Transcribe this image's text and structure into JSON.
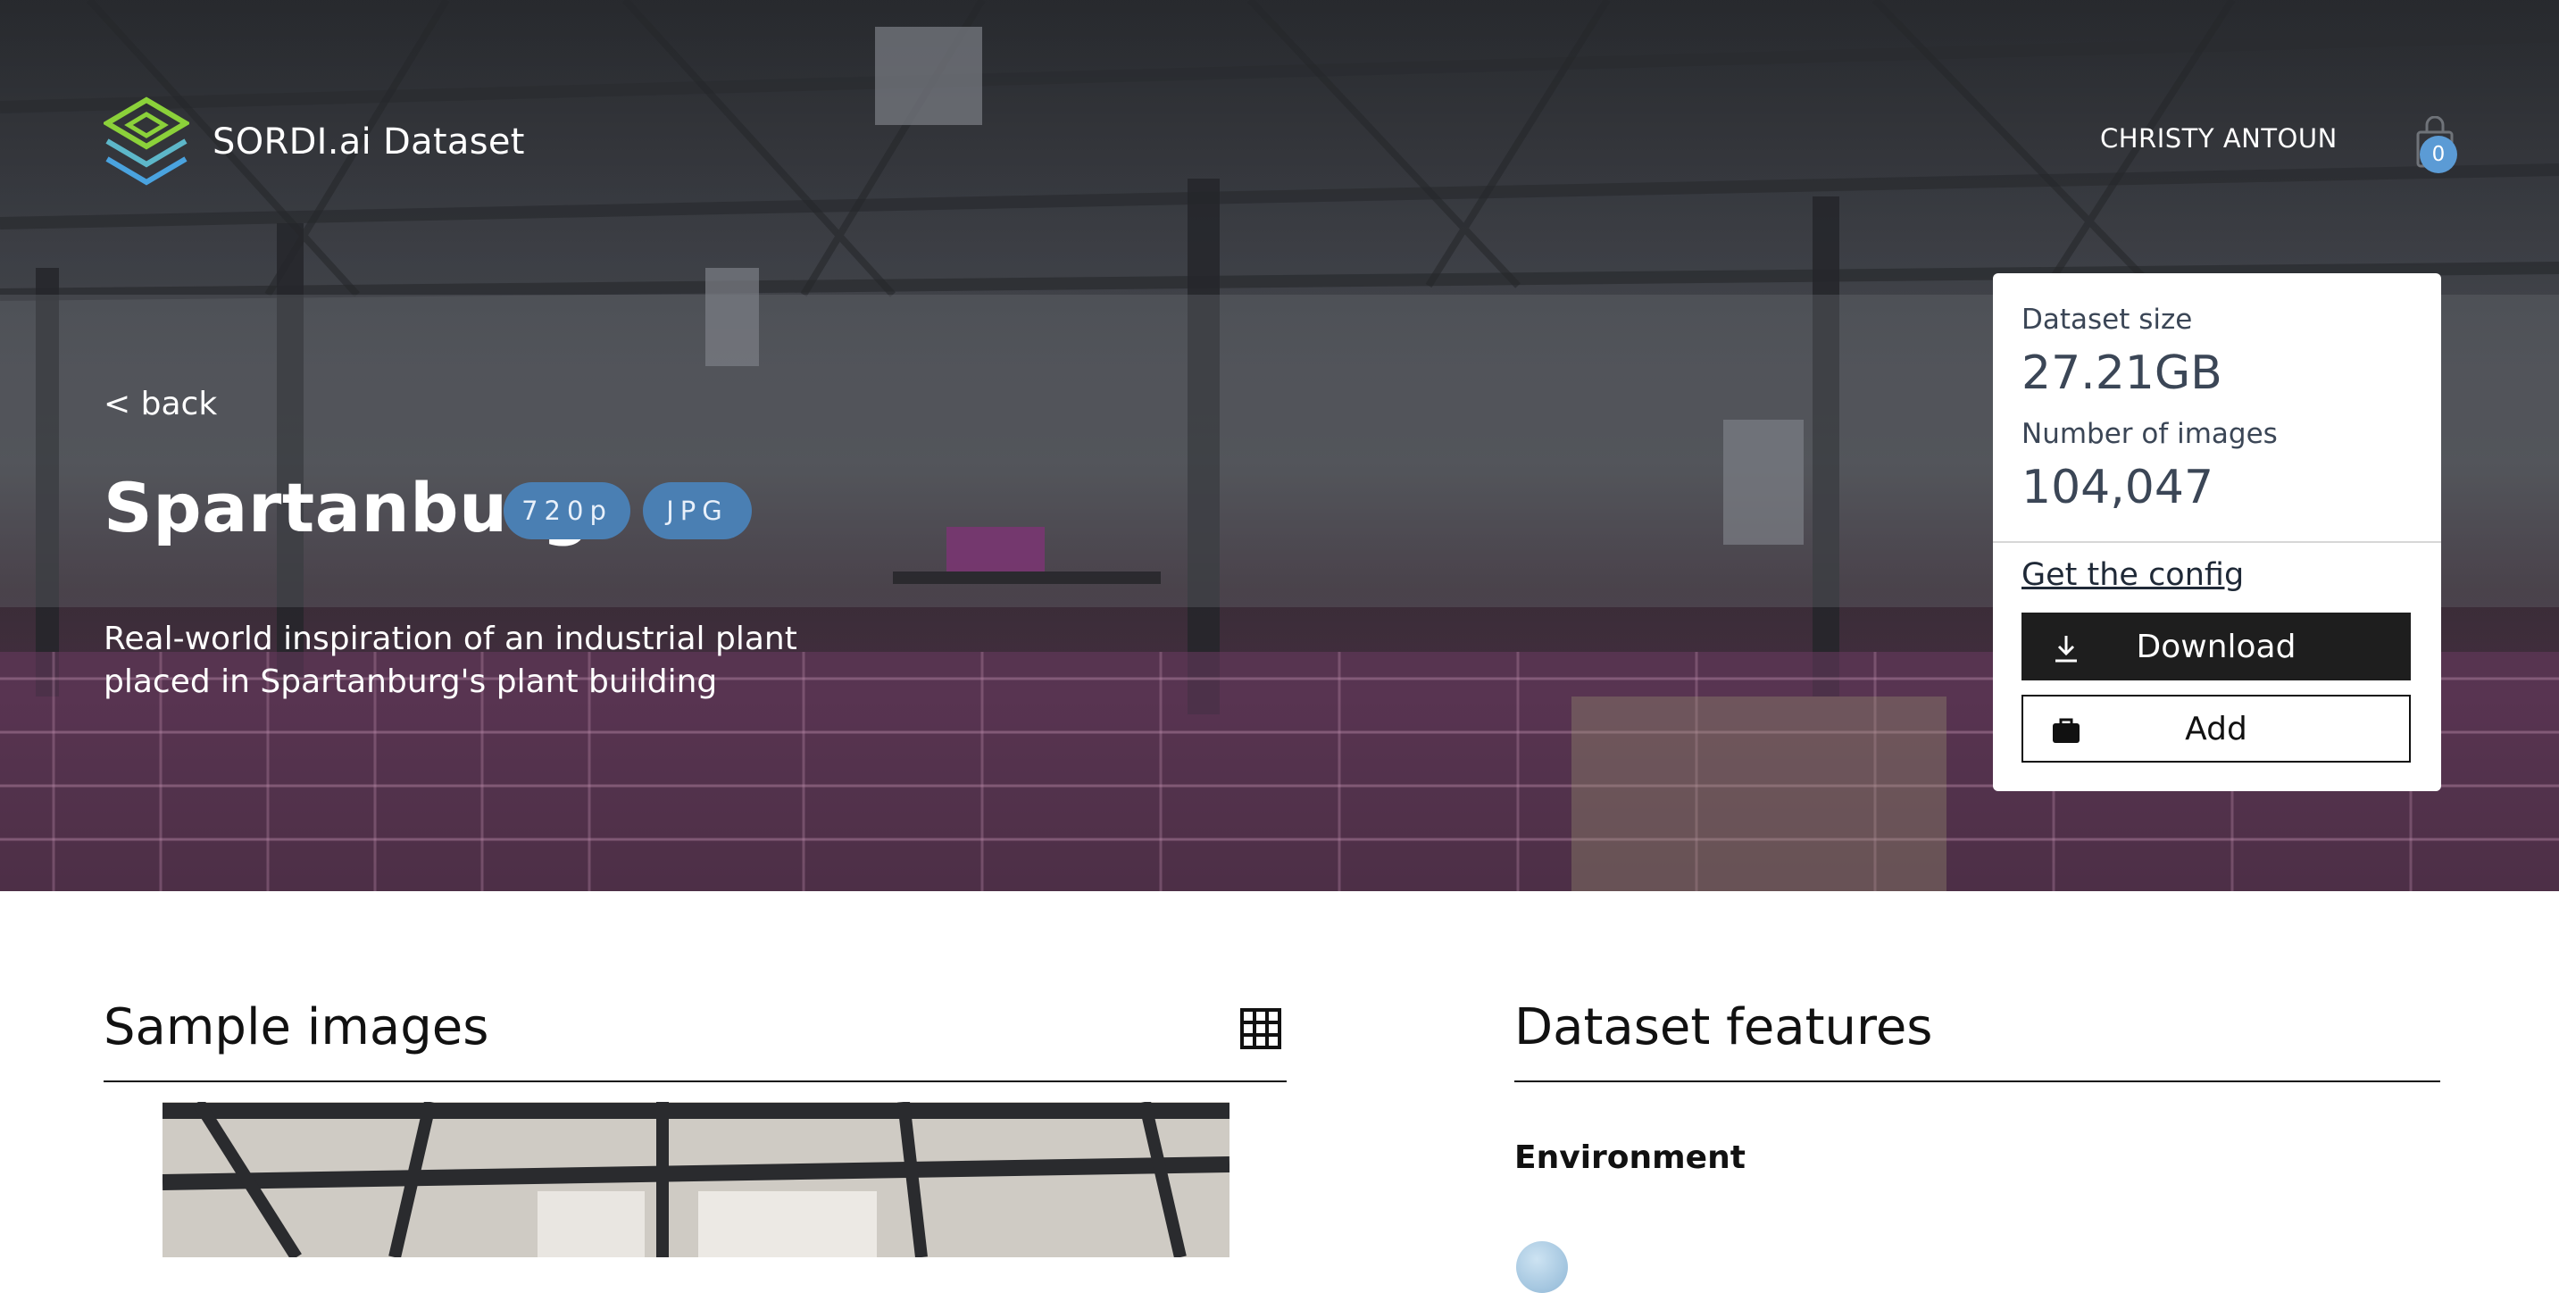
{
  "header": {
    "brand": "SORDI.ai Dataset",
    "user_name": "CHRISTY ANTOUN",
    "cart_count": "0"
  },
  "hero": {
    "back_label": "< back",
    "title": "Spartanburg",
    "badges": [
      "720p",
      "JPG"
    ],
    "description": "Real-world inspiration of an industrial plant placed in Spartanburg's plant building"
  },
  "info_card": {
    "size_label": "Dataset size",
    "size_value": "27.21GB",
    "images_label": "Number of images",
    "images_value": "104,047",
    "config_link": "Get the config",
    "download_label": "Download",
    "add_label": "Add"
  },
  "sections": {
    "samples_title": "Sample images",
    "features_title": "Dataset features",
    "environment_heading": "Environment"
  },
  "icons": {
    "logo": "sordi-logo-icon",
    "cart": "shopping-bag-icon",
    "download": "download-icon",
    "add": "briefcase-icon",
    "grid": "grid-view-icon"
  },
  "colors": {
    "badge_bg": "#4a7fb3",
    "cart_badge_bg": "#5b9bd5",
    "button_dark": "#1e1e1e",
    "logo_green": "#8bd13a",
    "logo_blue": "#4aa3df"
  }
}
